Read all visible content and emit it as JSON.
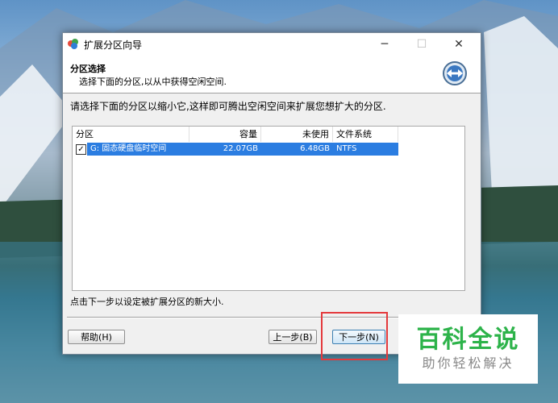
{
  "window": {
    "title": "扩展分区向导",
    "minimize": "─",
    "maximize": "☐",
    "close": "✕"
  },
  "header": {
    "title": "分区选择",
    "subtitle": "选择下面的分区,以从中获得空闲空间."
  },
  "instruction": "请选择下面的分区以缩小它,这样即可腾出空闲空间来扩展您想扩大的分区.",
  "partition_list": {
    "columns": [
      "分区",
      "容量",
      "未使用",
      "文件系统"
    ],
    "rows": [
      {
        "checked": true,
        "checkmark": "✓",
        "name": "G: 固态硬盘临时空间",
        "capacity": "22.07GB",
        "unused": "6.48GB",
        "filesystem": "NTFS"
      }
    ]
  },
  "footer_text": "点击下一步以设定被扩展分区的新大小.",
  "buttons": {
    "help": "帮助(H)",
    "back": "上一步(B)",
    "next": "下一步(N)"
  },
  "watermark": {
    "main": "百科全说",
    "sub": "助你轻松解决"
  },
  "colors": {
    "selection": "#2b7de1",
    "highlight_box": "#e4393c",
    "watermark_green": "#2db34a"
  }
}
